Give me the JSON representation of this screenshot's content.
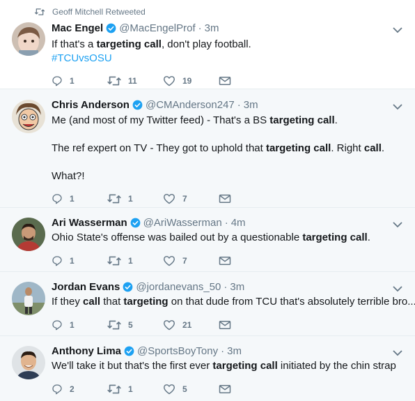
{
  "context": {
    "icon": "retweet-icon",
    "label": "Geoff Mitchell Retweeted"
  },
  "colors": {
    "accent": "#1da1f2",
    "muted": "#657786",
    "border": "#e6ecf0",
    "alt_bg": "#f5f8fa"
  },
  "tweets": [
    {
      "name": "Mac Engel",
      "handle": "@MacEngelProf",
      "time": "3m",
      "segments": [
        {
          "t": "If that's a ",
          "b": false
        },
        {
          "t": "targeting call",
          "b": true
        },
        {
          "t": ", don't play football.",
          "b": false
        }
      ],
      "hashtag": "#TCUvsOSU",
      "replies": "1",
      "retweets": "11",
      "likes": "19"
    },
    {
      "name": "Chris Anderson",
      "handle": "@CMAnderson247",
      "time": "3m",
      "lines": [
        [
          {
            "t": "Me (and most of my Twitter feed) - That's a BS ",
            "b": false
          },
          {
            "t": "targeting call",
            "b": true
          },
          {
            "t": ".",
            "b": false
          }
        ],
        [
          {
            "t": "The ref expert on TV - They got to uphold that ",
            "b": false
          },
          {
            "t": "targeting call",
            "b": true
          },
          {
            "t": ". Right ",
            "b": false
          },
          {
            "t": "call",
            "b": true
          },
          {
            "t": ".",
            "b": false
          }
        ],
        [
          {
            "t": "What?!",
            "b": false
          }
        ]
      ],
      "replies": "1",
      "retweets": "1",
      "likes": "7"
    },
    {
      "name": "Ari Wasserman",
      "handle": "@AriWasserman",
      "time": "4m",
      "segments": [
        {
          "t": "Ohio State's offense was bailed out by a questionable ",
          "b": false
        },
        {
          "t": "targeting call",
          "b": true
        },
        {
          "t": ".",
          "b": false
        }
      ],
      "replies": "1",
      "retweets": "1",
      "likes": "7"
    },
    {
      "name": "Jordan Evans",
      "handle": "@jordanevans_50",
      "time": "3m",
      "segments": [
        {
          "t": "If they ",
          "b": false
        },
        {
          "t": "call",
          "b": true
        },
        {
          "t": " that ",
          "b": false
        },
        {
          "t": "targeting",
          "b": true
        },
        {
          "t": " on that dude from TCU that's absolutely terrible bro...",
          "b": false
        }
      ],
      "replies": "1",
      "retweets": "5",
      "likes": "21"
    },
    {
      "name": "Anthony Lima",
      "handle": "@SportsBoyTony",
      "time": "3m",
      "segments": [
        {
          "t": "We'll take it but that's the first ever ",
          "b": false
        },
        {
          "t": "targeting call",
          "b": true
        },
        {
          "t": " initiated by the chin strap",
          "b": false
        }
      ],
      "replies": "2",
      "retweets": "1",
      "likes": "5"
    }
  ]
}
